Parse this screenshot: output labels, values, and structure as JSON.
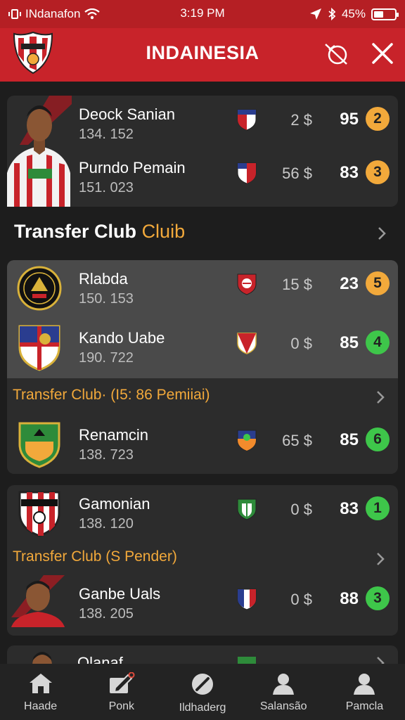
{
  "status_bar": {
    "carrier": "INdanafon",
    "time": "3:19 PM",
    "battery": "45%",
    "battery_level": 0.45
  },
  "header": {
    "title": "INDAINESIA"
  },
  "top_card": {
    "rows": [
      {
        "name": "Deock Sanian",
        "sub": "134. 152",
        "price": "2 $",
        "rating": "95",
        "rank": "2",
        "rank_color": "orange"
      },
      {
        "name": "Purndo Pemain",
        "sub": "151. 023",
        "price": "56 $",
        "rating": "83",
        "rank": "3",
        "rank_color": "orange"
      }
    ]
  },
  "section": {
    "title": "Transfer Club",
    "accent": "Cluib"
  },
  "card_two": {
    "rows": [
      {
        "name": "Rlabda",
        "sub": "150. 153",
        "price": "15 $",
        "rating": "23",
        "rank": "5",
        "rank_color": "orange"
      },
      {
        "name": "Kando Uabe",
        "sub": "190. 722",
        "price": "0 $",
        "rating": "85",
        "rank": "4",
        "rank_color": "green"
      }
    ],
    "subheader": "Transfer Club· (I5: 86 Pemiiai)",
    "rows_after": [
      {
        "name": "Renamcin",
        "sub": "138. 723",
        "price": "65 $",
        "rating": "85",
        "rank": "6",
        "rank_color": "green"
      }
    ]
  },
  "card_three": {
    "rows": [
      {
        "name": "Gamonian",
        "sub": "138. 120",
        "price": "0 $",
        "rating": "83",
        "rank": "1",
        "rank_color": "green"
      }
    ],
    "subheader": "Transfer Club (S Pender)",
    "rows_after": [
      {
        "name": "Ganbe Uals",
        "sub": "138. 205",
        "price": "0 $",
        "rating": "88",
        "rank": "3",
        "rank_color": "green"
      }
    ]
  },
  "card_four": {
    "partial_name": "Olanaf"
  },
  "bottom_nav": [
    {
      "label": "Haade",
      "icon": "home-icon"
    },
    {
      "label": "Ponk",
      "icon": "edit-icon"
    },
    {
      "label": "Ildhaderg",
      "icon": "check-circle-icon"
    },
    {
      "label": "Salansão",
      "icon": "person-icon"
    },
    {
      "label": "Pamcla",
      "icon": "person-icon"
    }
  ],
  "colors": {
    "brand_red": "#c8232a",
    "status_red": "#b51f24",
    "accent_orange": "#f2a93b",
    "rank_green": "#3ec64a",
    "background": "#1d1d1d"
  }
}
